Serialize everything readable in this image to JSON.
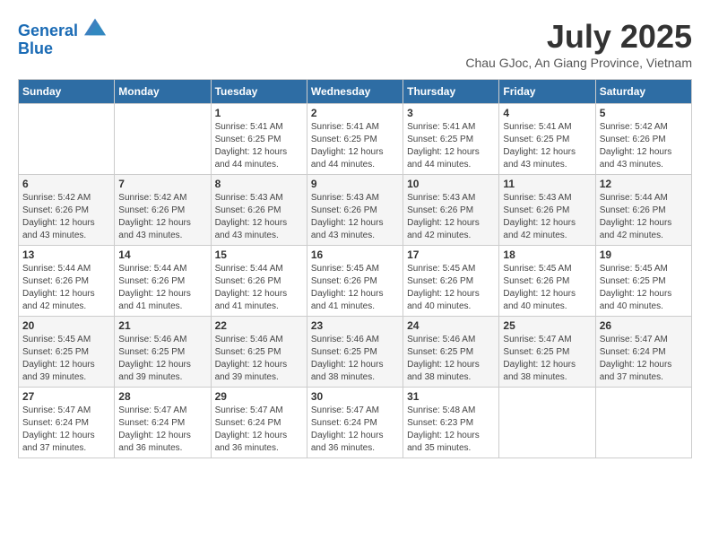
{
  "header": {
    "logo_line1": "General",
    "logo_line2": "Blue",
    "month_year": "July 2025",
    "location": "Chau GJoc, An Giang Province, Vietnam"
  },
  "weekdays": [
    "Sunday",
    "Monday",
    "Tuesday",
    "Wednesday",
    "Thursday",
    "Friday",
    "Saturday"
  ],
  "weeks": [
    [
      {
        "day": "",
        "info": ""
      },
      {
        "day": "",
        "info": ""
      },
      {
        "day": "1",
        "info": "Sunrise: 5:41 AM\nSunset: 6:25 PM\nDaylight: 12 hours\nand 44 minutes."
      },
      {
        "day": "2",
        "info": "Sunrise: 5:41 AM\nSunset: 6:25 PM\nDaylight: 12 hours\nand 44 minutes."
      },
      {
        "day": "3",
        "info": "Sunrise: 5:41 AM\nSunset: 6:25 PM\nDaylight: 12 hours\nand 44 minutes."
      },
      {
        "day": "4",
        "info": "Sunrise: 5:41 AM\nSunset: 6:25 PM\nDaylight: 12 hours\nand 43 minutes."
      },
      {
        "day": "5",
        "info": "Sunrise: 5:42 AM\nSunset: 6:26 PM\nDaylight: 12 hours\nand 43 minutes."
      }
    ],
    [
      {
        "day": "6",
        "info": "Sunrise: 5:42 AM\nSunset: 6:26 PM\nDaylight: 12 hours\nand 43 minutes."
      },
      {
        "day": "7",
        "info": "Sunrise: 5:42 AM\nSunset: 6:26 PM\nDaylight: 12 hours\nand 43 minutes."
      },
      {
        "day": "8",
        "info": "Sunrise: 5:43 AM\nSunset: 6:26 PM\nDaylight: 12 hours\nand 43 minutes."
      },
      {
        "day": "9",
        "info": "Sunrise: 5:43 AM\nSunset: 6:26 PM\nDaylight: 12 hours\nand 43 minutes."
      },
      {
        "day": "10",
        "info": "Sunrise: 5:43 AM\nSunset: 6:26 PM\nDaylight: 12 hours\nand 42 minutes."
      },
      {
        "day": "11",
        "info": "Sunrise: 5:43 AM\nSunset: 6:26 PM\nDaylight: 12 hours\nand 42 minutes."
      },
      {
        "day": "12",
        "info": "Sunrise: 5:44 AM\nSunset: 6:26 PM\nDaylight: 12 hours\nand 42 minutes."
      }
    ],
    [
      {
        "day": "13",
        "info": "Sunrise: 5:44 AM\nSunset: 6:26 PM\nDaylight: 12 hours\nand 42 minutes."
      },
      {
        "day": "14",
        "info": "Sunrise: 5:44 AM\nSunset: 6:26 PM\nDaylight: 12 hours\nand 41 minutes."
      },
      {
        "day": "15",
        "info": "Sunrise: 5:44 AM\nSunset: 6:26 PM\nDaylight: 12 hours\nand 41 minutes."
      },
      {
        "day": "16",
        "info": "Sunrise: 5:45 AM\nSunset: 6:26 PM\nDaylight: 12 hours\nand 41 minutes."
      },
      {
        "day": "17",
        "info": "Sunrise: 5:45 AM\nSunset: 6:26 PM\nDaylight: 12 hours\nand 40 minutes."
      },
      {
        "day": "18",
        "info": "Sunrise: 5:45 AM\nSunset: 6:26 PM\nDaylight: 12 hours\nand 40 minutes."
      },
      {
        "day": "19",
        "info": "Sunrise: 5:45 AM\nSunset: 6:25 PM\nDaylight: 12 hours\nand 40 minutes."
      }
    ],
    [
      {
        "day": "20",
        "info": "Sunrise: 5:45 AM\nSunset: 6:25 PM\nDaylight: 12 hours\nand 39 minutes."
      },
      {
        "day": "21",
        "info": "Sunrise: 5:46 AM\nSunset: 6:25 PM\nDaylight: 12 hours\nand 39 minutes."
      },
      {
        "day": "22",
        "info": "Sunrise: 5:46 AM\nSunset: 6:25 PM\nDaylight: 12 hours\nand 39 minutes."
      },
      {
        "day": "23",
        "info": "Sunrise: 5:46 AM\nSunset: 6:25 PM\nDaylight: 12 hours\nand 38 minutes."
      },
      {
        "day": "24",
        "info": "Sunrise: 5:46 AM\nSunset: 6:25 PM\nDaylight: 12 hours\nand 38 minutes."
      },
      {
        "day": "25",
        "info": "Sunrise: 5:47 AM\nSunset: 6:25 PM\nDaylight: 12 hours\nand 38 minutes."
      },
      {
        "day": "26",
        "info": "Sunrise: 5:47 AM\nSunset: 6:24 PM\nDaylight: 12 hours\nand 37 minutes."
      }
    ],
    [
      {
        "day": "27",
        "info": "Sunrise: 5:47 AM\nSunset: 6:24 PM\nDaylight: 12 hours\nand 37 minutes."
      },
      {
        "day": "28",
        "info": "Sunrise: 5:47 AM\nSunset: 6:24 PM\nDaylight: 12 hours\nand 36 minutes."
      },
      {
        "day": "29",
        "info": "Sunrise: 5:47 AM\nSunset: 6:24 PM\nDaylight: 12 hours\nand 36 minutes."
      },
      {
        "day": "30",
        "info": "Sunrise: 5:47 AM\nSunset: 6:24 PM\nDaylight: 12 hours\nand 36 minutes."
      },
      {
        "day": "31",
        "info": "Sunrise: 5:48 AM\nSunset: 6:23 PM\nDaylight: 12 hours\nand 35 minutes."
      },
      {
        "day": "",
        "info": ""
      },
      {
        "day": "",
        "info": ""
      }
    ]
  ]
}
